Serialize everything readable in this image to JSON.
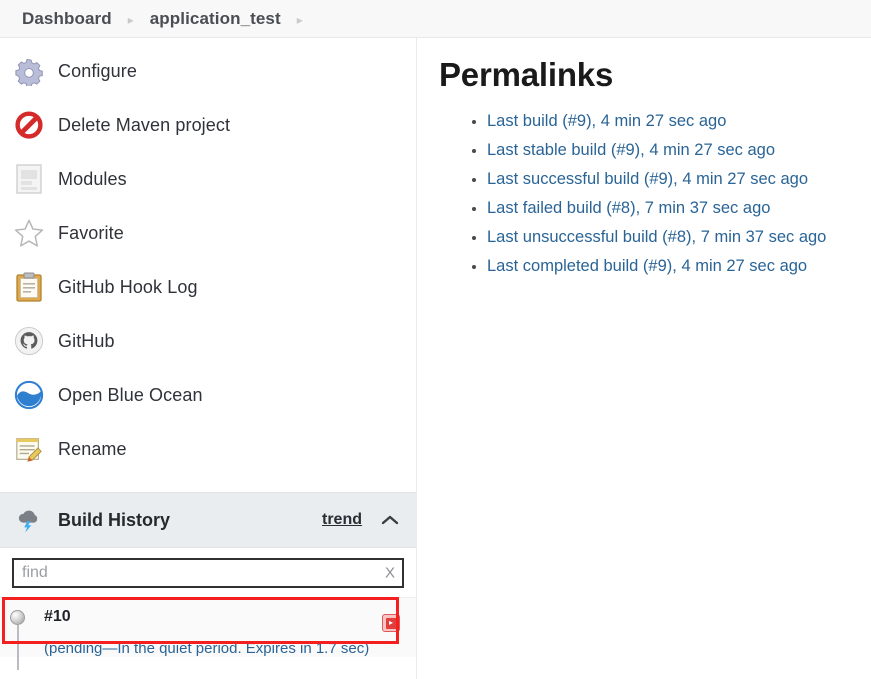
{
  "breadcrumb": {
    "items": [
      {
        "label": "Dashboard"
      },
      {
        "label": "application_test"
      }
    ],
    "separator": "▸"
  },
  "sidebar": {
    "tasks": [
      {
        "label": "Configure",
        "icon": "gear-icon"
      },
      {
        "label": "Delete Maven project",
        "icon": "delete-forbidden-icon"
      },
      {
        "label": "Modules",
        "icon": "document-page-icon"
      },
      {
        "label": "Favorite",
        "icon": "star-icon"
      },
      {
        "label": "GitHub Hook Log",
        "icon": "clipboard-icon"
      },
      {
        "label": "GitHub",
        "icon": "github-icon"
      },
      {
        "label": "Open Blue Ocean",
        "icon": "blue-ocean-icon"
      },
      {
        "label": "Rename",
        "icon": "rename-pencil-icon"
      }
    ],
    "build_history": {
      "title": "Build History",
      "icon": "cloud-lightning-icon",
      "trend_label": "trend",
      "collapse_icon": "chevron-up-icon",
      "search": {
        "placeholder": "find",
        "value": "",
        "clear_label": "X",
        "clear_icon": "close-x-icon"
      },
      "builds": [
        {
          "number": "#10",
          "status": "(pending—In the quiet period. Expires in 1.7 sec)",
          "status_icon": "pending-grey-ball-icon",
          "console_icon": "console-output-icon",
          "highlighted": true
        }
      ]
    }
  },
  "main": {
    "title": "Permalinks",
    "permalinks": [
      {
        "label": "Last build (#9), 4 min 27 sec ago"
      },
      {
        "label": "Last stable build (#9), 4 min 27 sec ago"
      },
      {
        "label": "Last successful build (#9), 4 min 27 sec ago"
      },
      {
        "label": "Last failed build (#8), 7 min 37 sec ago"
      },
      {
        "label": "Last unsuccessful build (#8), 7 min 37 sec ago"
      },
      {
        "label": "Last completed build (#9), 4 min 27 sec ago"
      }
    ]
  },
  "colors": {
    "link": "#2a6496",
    "highlight_box": "#f42020",
    "build_history_header_bg": "#e9edf0",
    "breadcrumb_bg": "#f8f8f9"
  }
}
